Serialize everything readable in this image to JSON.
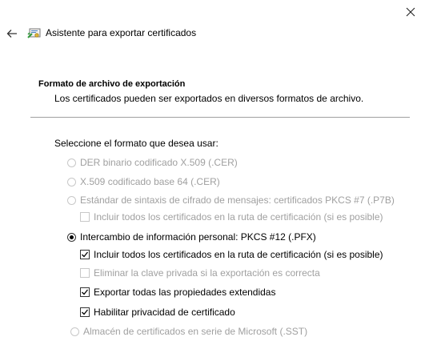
{
  "window": {
    "title": "Asistente para exportar certificados"
  },
  "header": {
    "title": "Formato de archivo de exportación",
    "description": "Los certificados pueden ser exportados en diversos formatos de archivo."
  },
  "prompt": "Seleccione el formato que desea usar:",
  "options": {
    "der": {
      "label": "DER binario codificado X.509 (.CER)",
      "selected": false,
      "enabled": false
    },
    "base64": {
      "label": "X.509 codificado base 64 (.CER)",
      "selected": false,
      "enabled": false
    },
    "pkcs7": {
      "label": "Estándar de sintaxis de cifrado de mensajes: certificados PKCS #7 (.P7B)",
      "selected": false,
      "enabled": false
    },
    "pkcs7_include_all": {
      "label": "Incluir todos los certificados en la ruta de certificación (si es posible)",
      "checked": false,
      "enabled": false
    },
    "pfx": {
      "label": "Intercambio de información personal: PKCS #12 (.PFX)",
      "selected": true,
      "enabled": true
    },
    "pfx_include_all": {
      "label": "Incluir todos los certificados en la ruta de certificación (si es posible)",
      "checked": true,
      "enabled": true
    },
    "pfx_delete_key": {
      "label": "Eliminar la clave privada si la exportación es correcta",
      "checked": false,
      "enabled": false
    },
    "pfx_export_props": {
      "label": "Exportar todas las propiedades extendidas",
      "checked": true,
      "enabled": true
    },
    "pfx_privacy": {
      "label": "Habilitar privacidad de certificado",
      "checked": true,
      "enabled": true
    },
    "sst": {
      "label": "Almacén de certificados en serie de Microsoft (.SST)",
      "selected": false,
      "enabled": false
    }
  }
}
